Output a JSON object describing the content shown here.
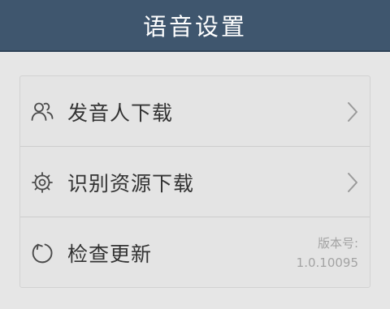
{
  "header": {
    "title": "语音设置"
  },
  "settings": {
    "items": [
      {
        "label": "发音人下载",
        "icon": "people-icon"
      },
      {
        "label": "识别资源下载",
        "icon": "gear-icon"
      },
      {
        "label": "检查更新",
        "icon": "refresh-icon"
      }
    ],
    "version_label": "版本号:",
    "version_value": "1.0.10095"
  },
  "colors": {
    "header_bg": "#3f566e",
    "page_bg": "#e6e6e6",
    "text": "#333333",
    "muted": "#a3a3a3"
  }
}
